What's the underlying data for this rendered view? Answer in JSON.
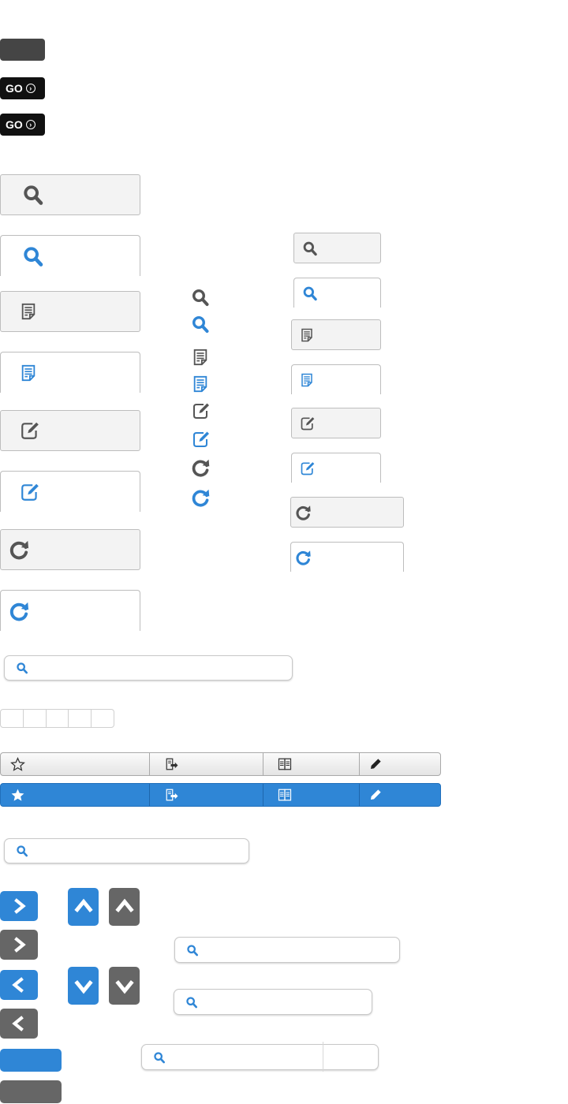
{
  "colors": {
    "accent": "#2f86d6",
    "icon_gray": "#555555",
    "dark_button": "#454545",
    "go_button": "#111111"
  },
  "buttons": {
    "go_label": "GO",
    "go_icon": "chevron-circle-right-icon"
  },
  "large_tiles": [
    {
      "icon": "search-icon",
      "state": "default"
    },
    {
      "icon": "search-icon",
      "state": "active"
    },
    {
      "icon": "document-icon",
      "state": "default"
    },
    {
      "icon": "document-icon",
      "state": "active"
    },
    {
      "icon": "edit-icon",
      "state": "default"
    },
    {
      "icon": "edit-icon",
      "state": "active"
    },
    {
      "icon": "refresh-icon",
      "state": "default"
    },
    {
      "icon": "refresh-icon",
      "state": "active"
    }
  ],
  "standalone_icons": [
    "search-icon",
    "search-icon",
    "document-icon",
    "document-icon",
    "edit-icon",
    "edit-icon",
    "refresh-icon",
    "refresh-icon"
  ],
  "small_tiles": [
    {
      "icon": "search-icon",
      "state": "default"
    },
    {
      "icon": "search-icon",
      "state": "active"
    },
    {
      "icon": "document-icon",
      "state": "default"
    },
    {
      "icon": "document-icon",
      "state": "active"
    },
    {
      "icon": "edit-icon",
      "state": "default"
    },
    {
      "icon": "edit-icon",
      "state": "active"
    },
    {
      "icon": "refresh-icon",
      "state": "default"
    },
    {
      "icon": "refresh-icon",
      "state": "active"
    }
  ],
  "search": {
    "placeholder": "",
    "value": ""
  },
  "toolbar": {
    "segments": [
      "star-icon",
      "export-icon",
      "copy-icon",
      "pencil-icon"
    ]
  },
  "arrows": [
    "chevron-right-icon",
    "chevron-left-icon",
    "chevron-up-icon",
    "chevron-down-icon"
  ]
}
